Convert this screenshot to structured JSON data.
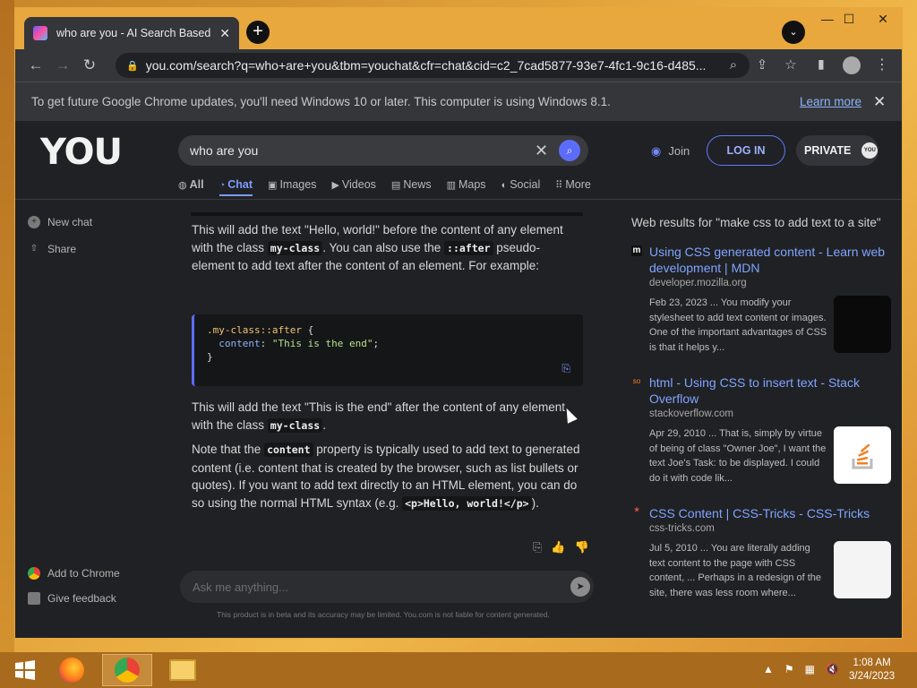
{
  "browser": {
    "tab_title": "who are you - AI Search Based C",
    "url": "you.com/search?q=who+are+you&tbm=youchat&cfr=chat&cid=c2_7cad5877-93e7-4fc1-9c16-d485...",
    "infobar_text": "To get future Google Chrome updates, you'll need Windows 10 or later. This computer is using Windows 8.1.",
    "infobar_link": "Learn more"
  },
  "site": {
    "logo": "YOU",
    "search_value": "who are you",
    "join_label": "Join",
    "login_label": "LOG IN",
    "private_label": "PRIVATE",
    "private_badge": "YOU",
    "tabs": [
      {
        "label": "All",
        "icon": "all-icon"
      },
      {
        "label": "Chat",
        "icon": "chat-icon"
      },
      {
        "label": "Images",
        "icon": "images-icon"
      },
      {
        "label": "Videos",
        "icon": "videos-icon"
      },
      {
        "label": "News",
        "icon": "news-icon"
      },
      {
        "label": "Maps",
        "icon": "maps-icon"
      },
      {
        "label": "Social",
        "icon": "social-icon"
      },
      {
        "label": "More",
        "icon": "more-icon"
      }
    ]
  },
  "sidebar": {
    "new_chat": "New chat",
    "share": "Share",
    "add_to_chrome": "Add to Chrome",
    "give_feedback": "Give feedback"
  },
  "chat": {
    "p1_a": "This will add the text \"Hello, world!\" before the content of any element with the class ",
    "p1_code1": "my-class",
    "p1_b": ". You can also use the ",
    "p1_code2": "::after",
    "p1_c": " pseudo-element to add text after the content of an element. For example:",
    "code_line1": ".my-class::after",
    "code_line2_prop": "content",
    "code_line2_val": "\"This is the end\"",
    "p2_a": "This will add the text \"This is the end\" after the content of any element with the class ",
    "p2_code": "my-class",
    "p2_b": ".",
    "p3_a": "Note that the ",
    "p3_code1": "content",
    "p3_b": " property is typically used to add text to generated content (i.e. content that is created by the browser, such as list bullets or quotes). If you want to add text directly to an HTML element, you can do so using the normal HTML syntax (e.g. ",
    "p3_code2": "<p>Hello, world!</p>",
    "p3_c": ").",
    "ask_placeholder": "Ask me anything...",
    "disclaimer": "This product is in beta and its accuracy may be limited. You.com is not liable for content generated."
  },
  "web": {
    "heading": "Web results for \"make css to add text to a site\"",
    "results": [
      {
        "title": "Using CSS generated content - Learn web development | MDN",
        "domain": "developer.mozilla.org",
        "snippet": "Feb 23, 2023 ... You modify your stylesheet to add text content or images. One of the important advantages of CSS is that it helps y...",
        "favicon": "m"
      },
      {
        "title": "html - Using CSS to insert text - Stack Overflow",
        "domain": "stackoverflow.com",
        "snippet": "Apr 29, 2010 ... That is, simply by virtue of being of class \"Owner Joe\", I want the text Joe's Task: to be displayed. I could do it with code lik...",
        "favicon": "so"
      },
      {
        "title": "CSS Content | CSS-Tricks - CSS-Tricks",
        "domain": "css-tricks.com",
        "snippet": "Jul 5, 2010 ... You are literally adding text content to the page with CSS content, ... Perhaps in a redesign of the site, there was less room where...",
        "favicon": "*"
      }
    ]
  },
  "taskbar": {
    "time": "1:08 AM",
    "date": "3/24/2023"
  }
}
